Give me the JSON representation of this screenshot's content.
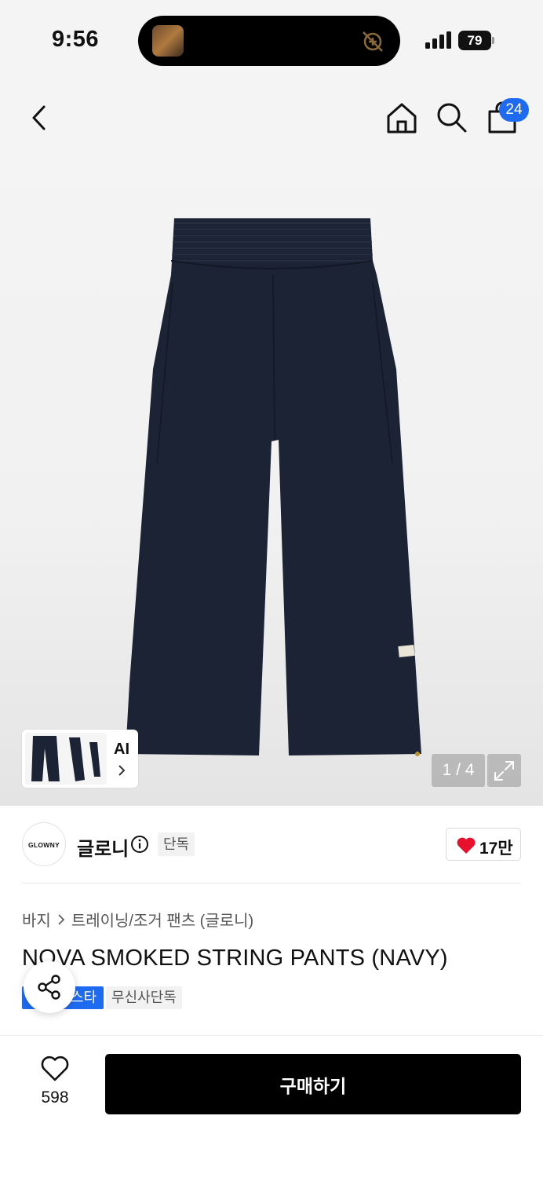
{
  "status_bar": {
    "time": "9:56",
    "battery": "79",
    "signal_icon": "cellular-signal-icon",
    "island_icon": "muted-activity-icon"
  },
  "top_nav": {
    "back_icon": "chevron-left-icon",
    "home_icon": "home-icon",
    "search_icon": "search-icon",
    "cart_icon": "shopping-bag-icon",
    "cart_count": "24"
  },
  "gallery": {
    "counter": "1 / 4",
    "ai_label": "AI",
    "expand_icon": "expand-icon",
    "product_color": "#1b2334"
  },
  "brand": {
    "logo_text": "GLOWNY",
    "name": "글로니",
    "exclusive_badge": "단독",
    "likes": "17만",
    "heart_color": "#e8112d"
  },
  "product": {
    "breadcrumb": [
      "바지",
      "트레이닝/조거 팬츠 (글로니)"
    ],
    "title": "NOVA SMOKED STRING PANTS (NAVY)",
    "tag_primary": "스타",
    "tag_secondary": "무신사단독"
  },
  "bottom_bar": {
    "wish_count": "598",
    "buy_label": "구매하기"
  }
}
